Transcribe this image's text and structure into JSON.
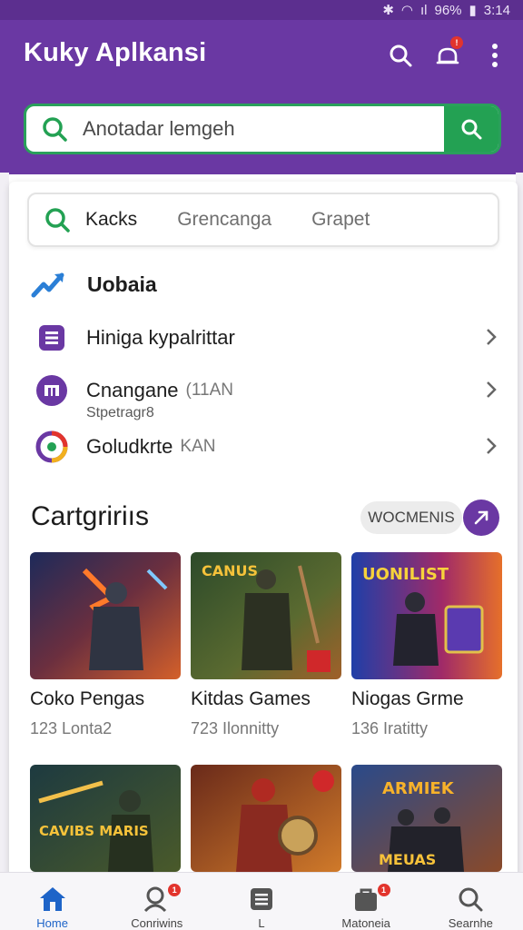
{
  "status_bar": {
    "signal": "ıl",
    "battery": "96%",
    "time": "3:14"
  },
  "app": {
    "title": "Kuky Aplkansi"
  },
  "search": {
    "placeholder": "Anotadar lemgeh"
  },
  "chips": [
    {
      "label": "Kacks"
    },
    {
      "label": "Grencanga"
    },
    {
      "label": "Grapet"
    }
  ],
  "suggestions": {
    "header": "Uobaia",
    "items": [
      {
        "label": "Hiniga kypalrittar",
        "meta": "",
        "sub": ""
      },
      {
        "label": "Cnangane",
        "meta": "(11AN",
        "sub": "Stpetragr8"
      },
      {
        "label": "Goludkrte",
        "meta": "KAN",
        "sub": ""
      }
    ]
  },
  "categories": {
    "title": "Cartgririıs",
    "more_label": "WOCMENIS",
    "cards": [
      {
        "title": "Coko Pengas",
        "count": "123 Lonta2"
      },
      {
        "title": "Kitdas Games",
        "count": "723 Ilonnitty"
      },
      {
        "title": "Niogas Grme",
        "count": "136 Iratitty"
      },
      {
        "title": "",
        "count": ""
      },
      {
        "title": "",
        "count": ""
      },
      {
        "title": "",
        "count": ""
      }
    ],
    "thumb_texts": [
      "CANUS",
      "UONILIST",
      "CAVIBS MARIS",
      "ARMIEK",
      "MEUAS"
    ]
  },
  "bottom_nav": [
    {
      "label": "Home",
      "icon": "home-icon"
    },
    {
      "label": "Conriwins",
      "icon": "person-search-icon",
      "badge": "1"
    },
    {
      "label": "L",
      "icon": "list-icon"
    },
    {
      "label": "Matoneia",
      "icon": "bag-icon",
      "badge": "1"
    },
    {
      "label": "Searnhe",
      "icon": "search-icon"
    }
  ],
  "colors": {
    "primary": "#6a38a3",
    "accent_green": "#23a153",
    "nav_active": "#1e64c8"
  }
}
